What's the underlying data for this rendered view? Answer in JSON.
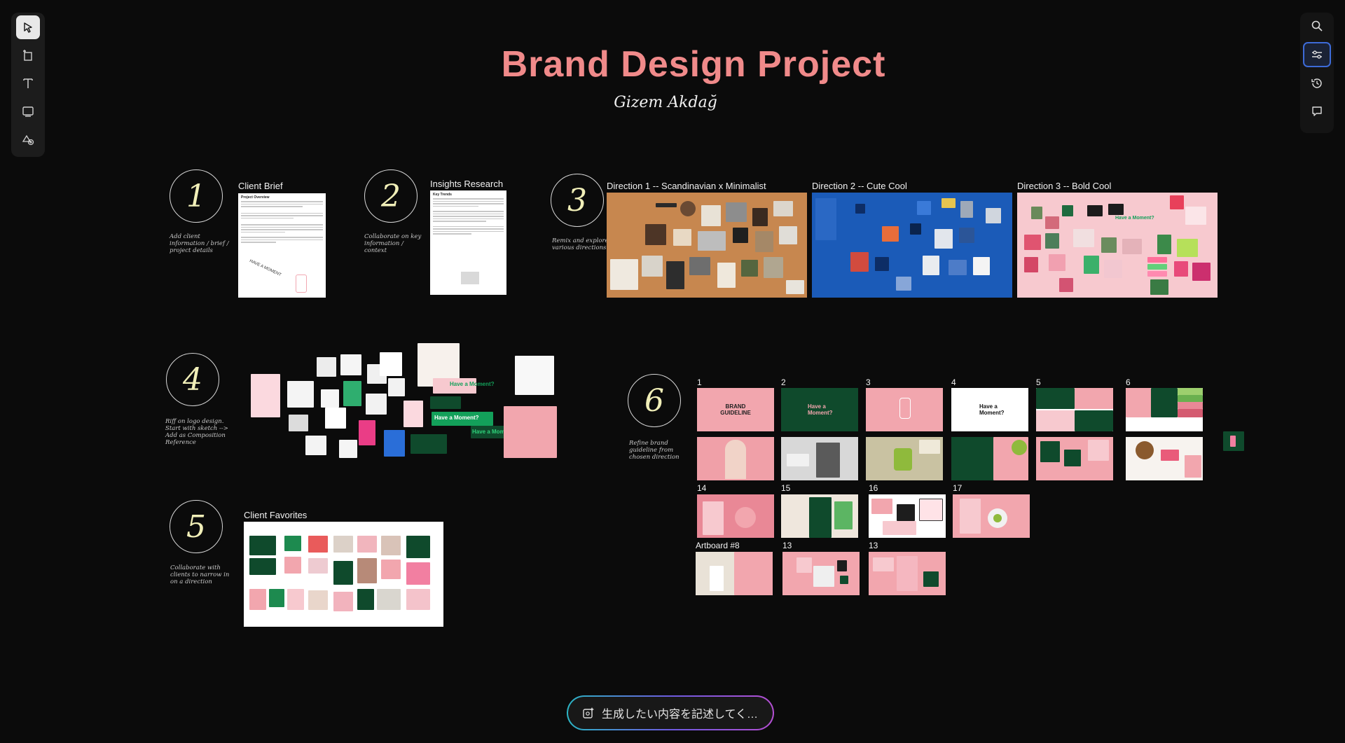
{
  "app": {
    "title": "Brand Design Project",
    "author": "Gizem Akdağ"
  },
  "toolbar_left": {
    "tools": [
      {
        "name": "select-tool",
        "icon": "cursor-icon"
      },
      {
        "name": "page-tool",
        "icon": "page-icon"
      },
      {
        "name": "text-tool",
        "icon": "text-icon"
      },
      {
        "name": "shape-tool",
        "icon": "rectangle-icon"
      },
      {
        "name": "assets-tool",
        "icon": "shapes-plus-icon"
      }
    ]
  },
  "toolbar_right": {
    "tools": [
      {
        "name": "search",
        "icon": "search-icon"
      },
      {
        "name": "adjust",
        "icon": "sliders-icon"
      },
      {
        "name": "history",
        "icon": "history-icon"
      },
      {
        "name": "comments",
        "icon": "comment-icon"
      }
    ]
  },
  "steps": {
    "s1": {
      "num": "1",
      "note": "Add client information / brief / project details"
    },
    "s2": {
      "num": "2",
      "note": "Collaborate on key information / context"
    },
    "s3": {
      "num": "3",
      "note": "Remix and explore various directions"
    },
    "s4": {
      "num": "4",
      "note": "Riff on logo design. Start with sketch --> Add as Composition Reference"
    },
    "s5": {
      "num": "5",
      "note": "Collaborate with clients to narrow in on a direction"
    },
    "s6": {
      "num": "6",
      "note": "Refine brand guideline from chosen direction"
    }
  },
  "frames": {
    "client_brief": "Client Brief",
    "insights": "Insights Research",
    "dir1": "Direction 1 -- Scandinavian x Minimalist",
    "dir2": "Direction 2 -- Cute Cool",
    "dir3": "Direction 3 -- Bold Cool",
    "favorites": "Client Favorites"
  },
  "docs": {
    "brief_heading": "Project Overview",
    "brief_stamp": "HAVE A MOMENT",
    "insights_heading": "Key Trends"
  },
  "artboards": {
    "labels": [
      "1",
      "2",
      "3",
      "4",
      "5",
      "6",
      "14",
      "15",
      "16",
      "17",
      "Artboard #8",
      "13",
      "13"
    ],
    "brand_guideline": "BRAND GUIDELINE",
    "have_a_moment": "Have a Moment?"
  },
  "logo_text": {
    "a": "Have a Moment?",
    "b": "Have a Moment?",
    "c": "Have a Moment?"
  },
  "prompt": {
    "placeholder": "生成したい内容を記述してく…",
    "icon": "generate-icon"
  },
  "colors": {
    "title": "#f08a8a",
    "brand_pink": "#f2a8b2",
    "brand_green": "#0f4a2c",
    "accent_blue": "#3d6bd8"
  }
}
